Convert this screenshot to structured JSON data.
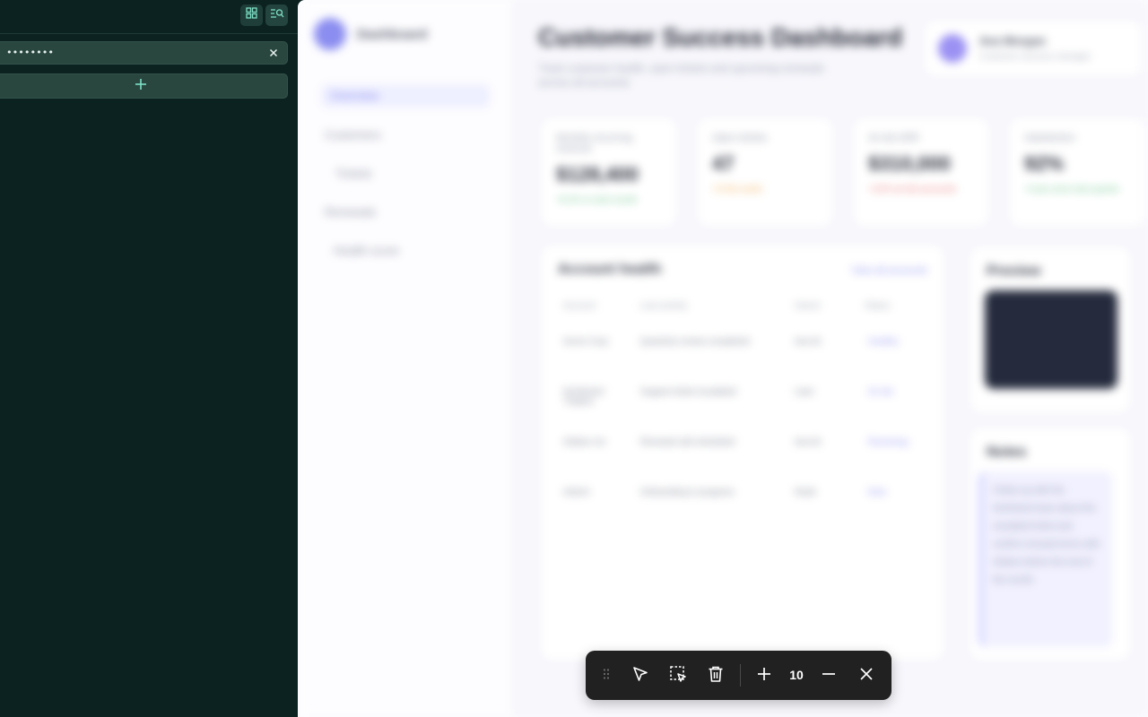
{
  "left_panel": {
    "password_value": "••••••••",
    "add_label": "+",
    "header_icons": [
      "grid-icon",
      "search-list-icon"
    ]
  },
  "dashboard": {
    "app_name": "Dashboard",
    "title": "Customer Success Dashboard",
    "subtitle": "Track customer health, open tickets and upcoming renewals across all accounts",
    "nav": [
      "Overview",
      "Customers",
      "Tickets",
      "Renewals",
      "Health score"
    ],
    "user": {
      "name": "Ava Morgan",
      "role": "Customer success manager"
    },
    "stats": [
      {
        "label": "Monthly recurring revenue",
        "value": "$128,400",
        "delta": "+8.2% vs last month",
        "delta_color": "#66c28a"
      },
      {
        "label": "Open tickets",
        "value": "47",
        "delta": "+5 this week",
        "delta_color": "#f0a94a"
      },
      {
        "label": "At-risk ARR",
        "value": "$310,000",
        "delta": "+12% at risk accounts",
        "delta_color": "#e86a6a"
      },
      {
        "label": "Satisfaction",
        "value": "92%",
        "delta": "+3 pts since last quarter",
        "delta_color": "#66c28a"
      }
    ],
    "accounts": {
      "title": "Account health",
      "link": "View all accounts",
      "columns": [
        "Account",
        "Last activity",
        "Owner",
        "Status"
      ],
      "rows": [
        {
          "account": "Acme Corp",
          "activity": "Quarterly review completed",
          "owner": "Ava M.",
          "status": "Healthy"
        },
        {
          "account": "Northwind Traders",
          "activity": "Support ticket escalated",
          "owner": "Liam",
          "status": "At risk"
        },
        {
          "account": "Globex Inc",
          "activity": "Renewal call scheduled",
          "owner": "Ava M.",
          "status": "Renewing"
        },
        {
          "account": "Initech",
          "activity": "Onboarding in progress",
          "owner": "Noah",
          "status": "New"
        }
      ]
    },
    "preview_title": "Preview",
    "notes_title": "Notes",
    "notes_text": "Follow up with the Northwind team about the escalated ticket and confirm renewal terms with Globex before the end of the month."
  },
  "toolbar": {
    "count": "10",
    "tools": [
      "drag-handle-icon",
      "pointer-icon",
      "area-select-icon",
      "trash-icon",
      "plus-icon",
      "minus-icon",
      "close-icon"
    ]
  },
  "colors": {
    "left_bg": "#0c2220",
    "field_bg": "#29473f",
    "accent": "#8b8df0",
    "toolbar_bg": "#212121"
  }
}
